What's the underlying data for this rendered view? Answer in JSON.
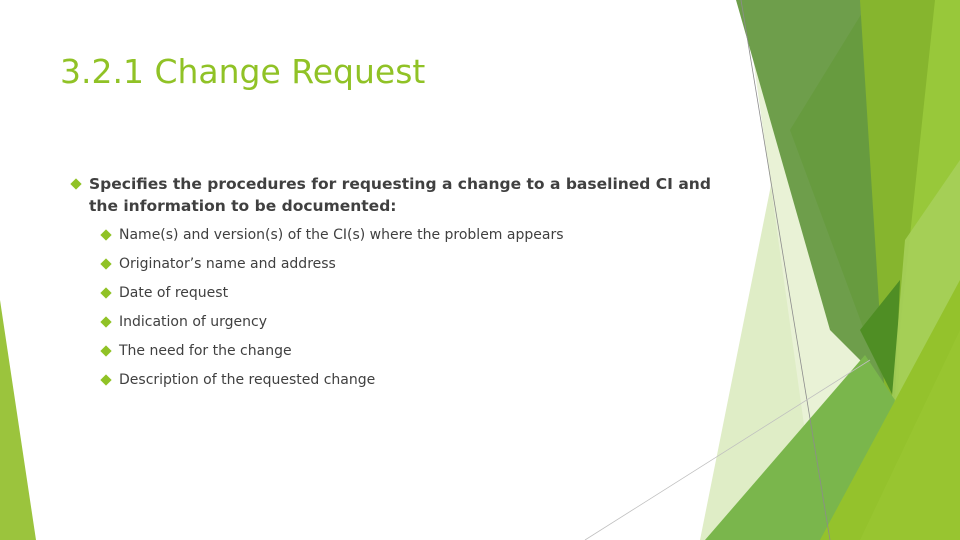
{
  "slide": {
    "title": "3.2.1 Change Request",
    "main_bullet": "Specifies the procedures for requesting a change to a baselined CI and the information to be documented:",
    "sub_bullets": [
      "Name(s) and version(s) of the CI(s) where the problem appears",
      "Originator’s name and address",
      "Date of request",
      "Indication of urgency",
      "The need for the change",
      "Description of the requested change"
    ],
    "bullet_icon": "diamond-bullet",
    "colors": {
      "accent": "#90c226",
      "text": "#404040"
    }
  }
}
